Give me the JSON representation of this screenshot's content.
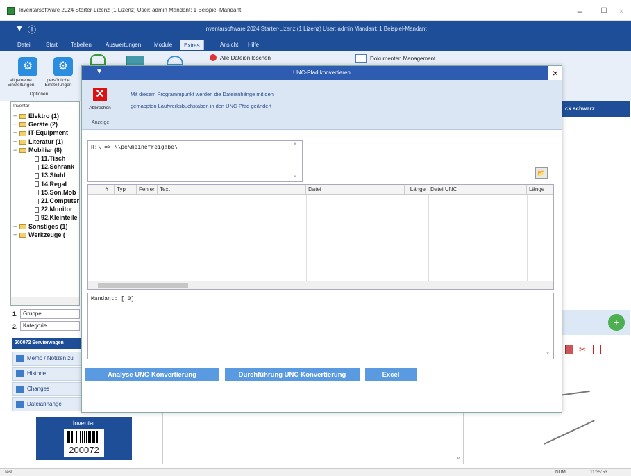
{
  "window": {
    "title": "Inventarsoftware 2024 Starter-Lizenz (1 Lizenz)   User: admin   Mandant: 1 Beispiel-Mandant",
    "min": "–",
    "max": "☐",
    "close": "×"
  },
  "ribbon_header": {
    "pin_icon": "▼",
    "info_icon": "ⓘ",
    "title": "Inventarsoftware 2024 Starter-Lizenz (1 Lizenz)   User: admin   Mandant: 1 Beispiel-Mandant"
  },
  "menu": [
    "Datei",
    "Start",
    "Tabellen",
    "Auswertungen",
    "Module",
    "Extras",
    "Ansicht",
    "Hilfe"
  ],
  "menu_active": "Extras",
  "ribbon": {
    "btn1_label": "allgemeine Einstellungen",
    "btn2_label": "persönliche Einstellungen",
    "group_label": "Optionen",
    "all_attachments": "Alle Dateien löschen",
    "doc_mgmt": "Dokumenten Management"
  },
  "tree": {
    "header": "Inventar",
    "items": [
      {
        "label": "Elektro  (1)",
        "type": "folder",
        "level": 0
      },
      {
        "label": "Geräte  (2)",
        "type": "folder",
        "level": 0
      },
      {
        "label": "IT-Equipment",
        "type": "folder",
        "level": 0
      },
      {
        "label": "Literatur  (1)",
        "type": "folder",
        "level": 0
      },
      {
        "label": "Mobiliar  (8)",
        "type": "folder",
        "level": 0
      },
      {
        "label": "11.Tisch",
        "type": "doc",
        "level": 1
      },
      {
        "label": "12.Schrank",
        "type": "doc",
        "level": 1
      },
      {
        "label": "13.Stuhl",
        "type": "doc",
        "level": 1
      },
      {
        "label": "14.Regal",
        "type": "doc",
        "level": 1
      },
      {
        "label": "15.Son.Mob",
        "type": "doc",
        "level": 1
      },
      {
        "label": "21.Computer",
        "type": "doc",
        "level": 1
      },
      {
        "label": "22.Monitor",
        "type": "doc",
        "level": 1
      },
      {
        "label": "92.Kleinteile",
        "type": "doc",
        "level": 1
      },
      {
        "label": "Sonstiges  (1)",
        "type": "folder",
        "level": 0
      },
      {
        "label": "Werkzeuge  (",
        "type": "folder",
        "level": 0
      }
    ]
  },
  "grouping": {
    "row1_num": "1.",
    "row1_value": "Gruppe",
    "row2_num": "2.",
    "row2_value": "Kategorie"
  },
  "left_nav": {
    "header": "200072 Servierwagen",
    "items": [
      "Memo / Notizen zu",
      "Historie",
      "Changes",
      "Dateianhänge"
    ]
  },
  "barcode": {
    "title": "Inventar",
    "number": "200072"
  },
  "right_panel": {
    "column_title": "ck schwarz"
  },
  "dialog": {
    "title": "UNC-Pfad konvertieren",
    "close": "×",
    "cancel_label": "Abbrechen",
    "view_label": "Anzeige",
    "description_line1": "Mit diesem Programmpunkt werden die Dateianhänge mit den",
    "description_line2": "gemappten Laufwerksbuchstaben in den UNC-Pfad geändert",
    "mapping_text": "R:\\ => \\\\pc\\meinefreigabe\\",
    "table_headers": [
      "#",
      "Typ",
      "Fehler",
      "Text",
      "Datei",
      "Länge",
      "Datei UNC",
      "Länge"
    ],
    "log_text": "Mandant: [    0]",
    "btn_analyse": "Analyse UNC-Konvertierung",
    "btn_execute": "Durchführung UNC-Konvertierung",
    "btn_excel": "Excel"
  },
  "statusbar": {
    "left": "Test",
    "num": "NUM",
    "time": "11:35:53"
  },
  "colors": {
    "ribbon_blue": "#1f4e99",
    "dialog_title": "#2d5cb0",
    "button_blue": "#5a9ae0",
    "cancel_red": "#d11111"
  }
}
